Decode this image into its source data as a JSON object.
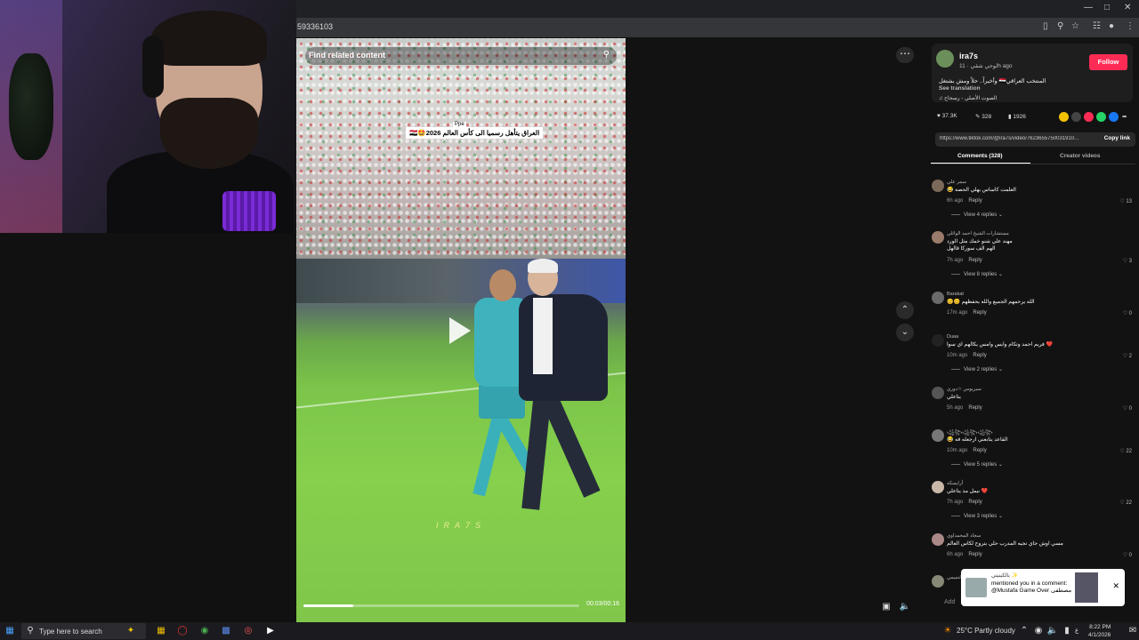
{
  "browser": {
    "url_fragment": "59336103"
  },
  "video": {
    "search_placeholder": "Find related content",
    "caption": "العراق يتأهل رسميا الى كأس العالم 2026🤩🇮🇶",
    "caption_tag": "Ppe",
    "watermark": "IRA7S",
    "time": "00:03/00:16",
    "progress": 0.18
  },
  "author": {
    "name": "ira7s",
    "handle_date": "لوحي شقي · 11h ago",
    "follow_label": "Follow",
    "description": "المنتخب العراقي🇮🇶 وأخيراً.. حلاً ومش بشتغل",
    "see_translation": "See translation",
    "music": "الصوت الأصلي - رسحاح"
  },
  "stats": {
    "likes": "37.3K",
    "comments": "328",
    "saves": "1926"
  },
  "share": {
    "link": "https://www.tiktok.com/@ira7s/video/7623655750031910...",
    "copy_label": "Copy link"
  },
  "tabs": {
    "comments": "Comments (328)",
    "creator_videos": "Creator videos"
  },
  "comments": [
    {
      "name": "سمر علي",
      "text": "العلمت كاساس يهلي الحصه 😂",
      "age": "6h ago",
      "reply": "Reply",
      "likes": "13",
      "replies": "View 4 replies"
    },
    {
      "name": "مستشارات الشيخ احمد الوائلي",
      "text": "مهند علي شنو خمك مثل الورد",
      "text2": "الهم الف سوركا قالهل",
      "age": "7h ago",
      "reply": "Reply",
      "likes": "3",
      "replies": "View 8 replies"
    },
    {
      "name": "Barakat",
      "text": "الله يرحمهم الجميع والله يحفظهم 😊😊",
      "age": "17m ago",
      "reply": "Reply",
      "likes": "0",
      "replies": ""
    },
    {
      "name": "Duaa",
      "text": "❤️ فريم احمد وتكام وايس وامس يكالهم اي سوا",
      "age": "10m ago",
      "reply": "Reply",
      "likes": "2",
      "replies": "View 2 replies"
    },
    {
      "name": "سيريوس ☆دوري",
      "text": "يتاعلي",
      "age": "5h ago",
      "reply": "Reply",
      "likes": "0",
      "replies": ""
    },
    {
      "name": "꧁꧂꧁꧂꧁꧂",
      "text": "القاعد يتابعني ارجعله قه 😂",
      "age": "10m ago",
      "reply": "Reply",
      "likes": "22",
      "replies": "View 5 replies"
    },
    {
      "name": "أرايسكه",
      "text": "❤️ نيمل مذ يتاعلي",
      "age": "7h ago",
      "reply": "Reply",
      "likes": "22",
      "replies": "View 3 replies"
    },
    {
      "name": "سجاد المحمداوي",
      "text": "مسي اوش جاي تجيه المدرب حلي يتروح لكاس العالم",
      "age": "6h ago",
      "reply": "Reply",
      "likes": "0",
      "replies": ""
    },
    {
      "name": "التميمي",
      "text": "...",
      "age": "",
      "reply": "",
      "likes": "",
      "replies": ""
    }
  ],
  "notification": {
    "user": "بالكيتيتي ✨",
    "text": "mentioned you in a comment: @Mustafa Game Over مصطفى",
    "close": "✕"
  },
  "add_comment_placeholder": "Add",
  "taskbar": {
    "search_placeholder": "Type here to search",
    "weather": "25°C  Partly cloudy",
    "lang": "ع",
    "time": "8:22 PM",
    "date": "4/1/2026"
  },
  "colors": {
    "follow": "#fe2c55",
    "panel_bg": "#121212"
  }
}
